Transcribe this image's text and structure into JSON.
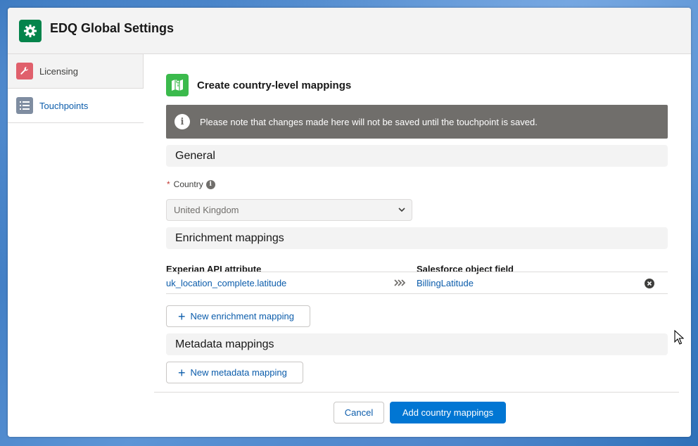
{
  "header": {
    "title": "EDQ Global Settings",
    "icon": "gear-icon",
    "icon_color": "#04844b"
  },
  "sidebar": {
    "items": [
      {
        "label": "Licensing",
        "icon": "wrench-icon",
        "color": "#e0606c",
        "active": false
      },
      {
        "label": "Touchpoints",
        "icon": "list-icon",
        "color": "#7f8da1",
        "active": true
      }
    ]
  },
  "main": {
    "title": "Create country-level mappings",
    "title_icon": "map-icon",
    "notice": "Please note that changes made here will not be saved until the touchpoint is saved.",
    "general": {
      "heading": "General",
      "country_label": "Country",
      "country_value": "United Kingdom"
    },
    "enrichment": {
      "heading": "Enrichment mappings",
      "col_api": "Experian API attribute",
      "col_sf": "Salesforce object field",
      "rows": [
        {
          "api": "uk_location_complete.latitude",
          "sf": "BillingLatitude"
        }
      ],
      "add_label": "New enrichment mapping"
    },
    "metadata": {
      "heading": "Metadata mappings",
      "add_label": "New metadata mapping"
    },
    "footer": {
      "cancel": "Cancel",
      "submit": "Add country mappings"
    }
  },
  "colors": {
    "brand": "#0176d3",
    "link": "#0b5cab",
    "notice_bg": "#706e6b"
  }
}
